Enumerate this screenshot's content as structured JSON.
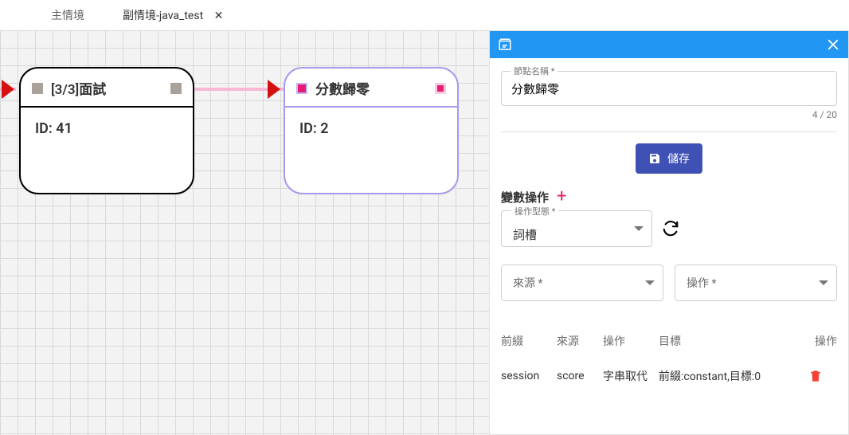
{
  "tabs": {
    "main": "主情境",
    "sub": "副情境-java_test",
    "close_glyph": "✕"
  },
  "nodes": {
    "a": {
      "title": "[3/3]面試",
      "id_line": "ID: 41"
    },
    "b": {
      "title": "分數歸零",
      "id_line": "ID: 2"
    }
  },
  "panel": {
    "name_label": "節點名稱 *",
    "name_value": "分數歸零",
    "counter": "4 / 20",
    "save": "儲存",
    "var_section": "變數操作",
    "plus": "+",
    "operation_type_label": "操作型態 *",
    "operation_type_value": "詞槽",
    "refresh_glyph": "↻",
    "source_label": "來源 *",
    "op_label": "操作 *",
    "table": {
      "headers": {
        "prefix": "前綴",
        "source": "來源",
        "op": "操作",
        "target": "目標",
        "act": "操作"
      },
      "rows": [
        {
          "prefix": "session",
          "source": "score",
          "op": "字串取代",
          "target": "前綴:constant,目標:0"
        }
      ]
    },
    "icons": {
      "node_box": "node-box-icon",
      "close": "close-icon",
      "save": "save-disk-icon",
      "trash": "trash-icon",
      "refresh": "refresh-icon",
      "dropdown": "chevron-down-icon"
    }
  }
}
